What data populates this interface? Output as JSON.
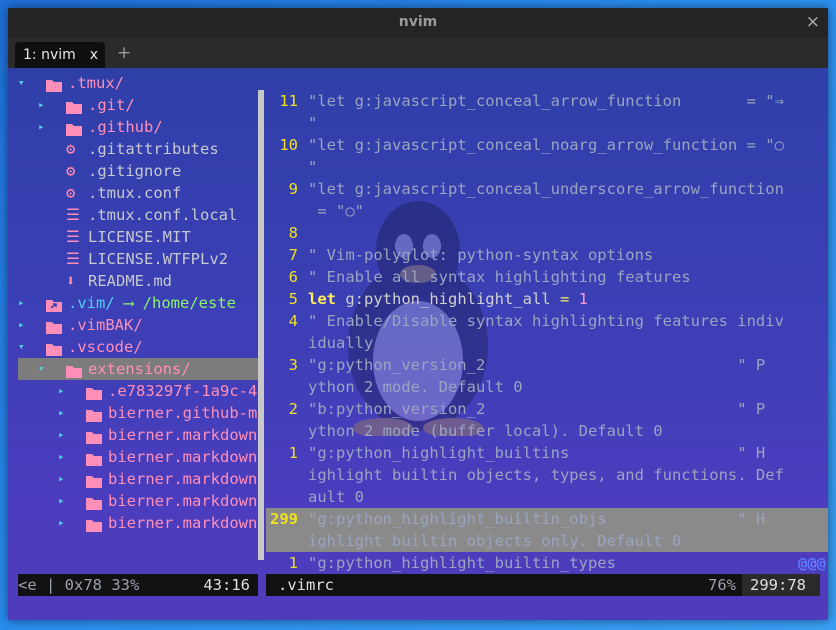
{
  "window": {
    "title": "nvim",
    "close_glyph": "×"
  },
  "tabs": [
    {
      "label": "1: nvim",
      "close": "x"
    }
  ],
  "new_tab": "+",
  "tree": [
    {
      "arrow": "▾",
      "icon": "folder-icon",
      "name": ".tmux/",
      "kind": "fold",
      "indent": 0
    },
    {
      "arrow": "▸",
      "icon": "folder-icon",
      "name": ".git/",
      "kind": "fold",
      "indent": 1
    },
    {
      "arrow": "▸",
      "icon": "folder-icon",
      "name": ".github/",
      "kind": "fold",
      "indent": 1
    },
    {
      "icon": "gear-icon",
      "name": ".gitattributes",
      "kind": "file",
      "indent": 1
    },
    {
      "icon": "gear-icon",
      "name": ".gitignore",
      "kind": "file",
      "indent": 1
    },
    {
      "icon": "gear-icon",
      "name": ".tmux.conf",
      "kind": "file",
      "indent": 1
    },
    {
      "icon": "lines-icon",
      "name": ".tmux.conf.local",
      "kind": "file",
      "indent": 1
    },
    {
      "icon": "lines-icon",
      "name": "LICENSE.MIT",
      "kind": "file",
      "indent": 1
    },
    {
      "icon": "lines-icon",
      "name": "LICENSE.WTFPLv2",
      "kind": "file",
      "indent": 1
    },
    {
      "icon": "download-icon",
      "name": "README.md",
      "kind": "file",
      "indent": 1
    },
    {
      "arrow": "▸",
      "icon": "link-folder-icon",
      "name": ".vim/",
      "link": " ⟶ /home/este",
      "kind": "link",
      "indent": 0
    },
    {
      "arrow": "▸",
      "icon": "folder-icon",
      "name": ".vimBAK/",
      "kind": "fold",
      "indent": 0
    },
    {
      "arrow": "▾",
      "icon": "folder-icon",
      "name": ".vscode/",
      "kind": "fold",
      "indent": 0
    },
    {
      "arrow": "▾",
      "icon": "folder-icon",
      "name": "extensions/",
      "kind": "fold",
      "indent": 1,
      "selected": true
    },
    {
      "arrow": "▸",
      "icon": "folder-icon",
      "name": ".e783297f-1a9c-4",
      "kind": "fold",
      "indent": 2
    },
    {
      "arrow": "▸",
      "icon": "folder-icon",
      "name": "bierner.github-m",
      "kind": "fold",
      "indent": 2
    },
    {
      "arrow": "▸",
      "icon": "folder-icon",
      "name": "bierner.markdown",
      "kind": "fold",
      "indent": 2
    },
    {
      "arrow": "▸",
      "icon": "folder-icon",
      "name": "bierner.markdown",
      "kind": "fold",
      "indent": 2
    },
    {
      "arrow": "▸",
      "icon": "folder-icon",
      "name": "bierner.markdown",
      "kind": "fold",
      "indent": 2
    },
    {
      "arrow": "▸",
      "icon": "folder-icon",
      "name": "bierner.markdown",
      "kind": "fold",
      "indent": 2
    },
    {
      "arrow": "▸",
      "icon": "folder-icon",
      "name": "bierner.markdown",
      "kind": "fold",
      "indent": 2
    }
  ],
  "code": [
    {
      "num": "11",
      "text": "\"let g:javascript_conceal_arrow_function       = \"⇒",
      "style": "cm"
    },
    {
      "num": "",
      "text": "\"",
      "style": "cm"
    },
    {
      "num": "10",
      "text": "\"let g:javascript_conceal_noarg_arrow_function = \"○",
      "style": "cm"
    },
    {
      "num": "",
      "text": "\"",
      "style": "cm"
    },
    {
      "num": "9",
      "text": "\"let g:javascript_conceal_underscore_arrow_function",
      "style": "cm"
    },
    {
      "num": "",
      "text": " = \"○\"",
      "style": "cm"
    },
    {
      "num": "8",
      "text": "",
      "style": "cm"
    },
    {
      "num": "7",
      "text": "\" Vim-polyglot: python-syntax options",
      "style": "cm"
    },
    {
      "num": "6",
      "text": "\" Enable all syntax highlighting features",
      "style": "cm"
    },
    {
      "num": "5",
      "kw": "let",
      "id": " g:python_highlight_all ",
      "op": "=",
      "val": " 1",
      "style": "let"
    },
    {
      "num": "4",
      "text": "\" Enable/Disable syntax highlighting features indiv",
      "style": "cm"
    },
    {
      "num": "",
      "text": "idually",
      "style": "cm"
    },
    {
      "num": "3",
      "text": "\"g:python_version_2                           \" P",
      "style": "cm"
    },
    {
      "num": "",
      "text": "ython 2 mode. Default 0",
      "style": "cm"
    },
    {
      "num": "2",
      "text": "\"b:python_version_2                           \" P",
      "style": "cm"
    },
    {
      "num": "",
      "text": "ython 2 mode (buffer local). Default 0",
      "style": "cm"
    },
    {
      "num": "1",
      "text": "\"g:python_highlight_builtins                  \" H",
      "style": "cm"
    },
    {
      "num": "",
      "text": "ighlight builtin objects, types, and functions. Def",
      "style": "cm"
    },
    {
      "num": "",
      "text": "ault 0",
      "style": "cm"
    },
    {
      "num": "299",
      "text": "\"g:python_highlight_builtin_objs              \" H",
      "style": "cm",
      "hl": true
    },
    {
      "num": "",
      "text": "ighlight builtin objects only. Default 0",
      "style": "cm",
      "hl": true
    },
    {
      "num": "1",
      "text": "\"g:python_highlight_builtin_types",
      "style": "cm",
      "trail": "@@@"
    }
  ],
  "status_left": {
    "text": "<e | 0x78   33%",
    "pos": "43:16"
  },
  "status_right": {
    "file": ".vimrc",
    "pct": "76%",
    "pos": "299:78"
  }
}
